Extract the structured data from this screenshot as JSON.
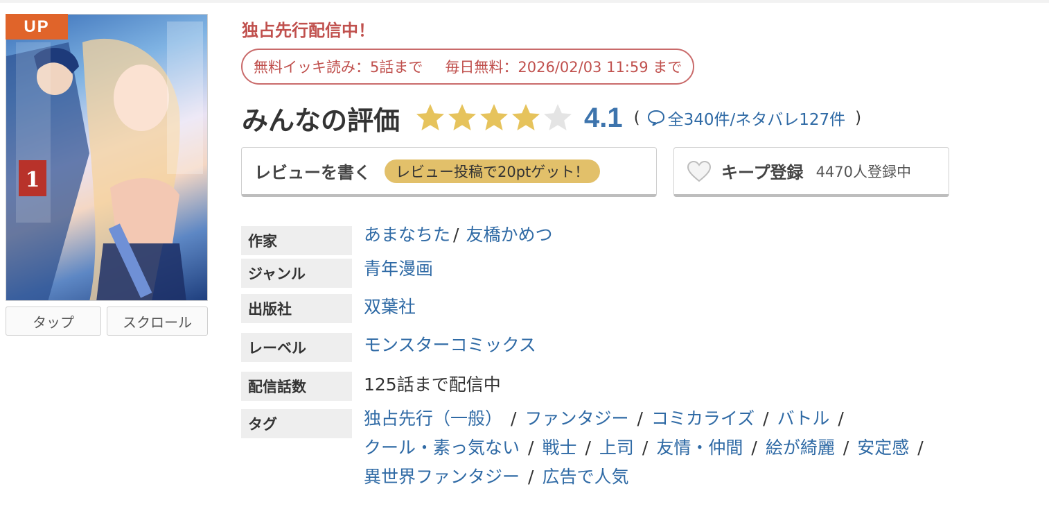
{
  "cover": {
    "badge": "UP",
    "tap_label": "タップ",
    "scroll_label": "スクロール"
  },
  "header": {
    "exclusive": "独占先行配信中！",
    "free_read": "無料イッキ読み：5話まで",
    "daily_free": "毎日無料：2026/02/03 11:59 まで"
  },
  "rating": {
    "label": "みんなの評価",
    "score": "4.1",
    "stars_value": 4.1,
    "stars_max": 5,
    "star_color": "#e6c35c",
    "star_empty_color": "#e4e4e4",
    "open_paren": "(",
    "total_reviews": "全340件",
    "spoiler_reviews": "/ネタバレ127件",
    "close_paren": ")"
  },
  "actions": {
    "review_label": "レビューを書く",
    "review_promo": "レビュー投稿で20ptゲット！",
    "keep_label": "キープ登録",
    "keep_count": "4470人登録中"
  },
  "details": {
    "author_label": "作家",
    "authors": [
      "あまなちた",
      "友橋かめつ"
    ],
    "author_sep": "/",
    "genre_label": "ジャンル",
    "genre": "青年漫画",
    "publisher_label": "出版社",
    "publisher": "双葉社",
    "label_label": "レーベル",
    "label": "モンスターコミックス",
    "episodes_label": "配信話数",
    "episodes": "125話まで配信中",
    "tags_label": "タグ",
    "tag_sep": "/",
    "tags": [
      [
        "独占先行（一般）",
        "ファンタジー",
        "コミカライズ",
        "バトル"
      ],
      [
        "クール・素っ気ない",
        "戦士",
        "上司",
        "友情・仲間",
        "絵が綺麗",
        "安定感"
      ],
      [
        "異世界ファンタジー",
        "広告で人気"
      ]
    ]
  }
}
